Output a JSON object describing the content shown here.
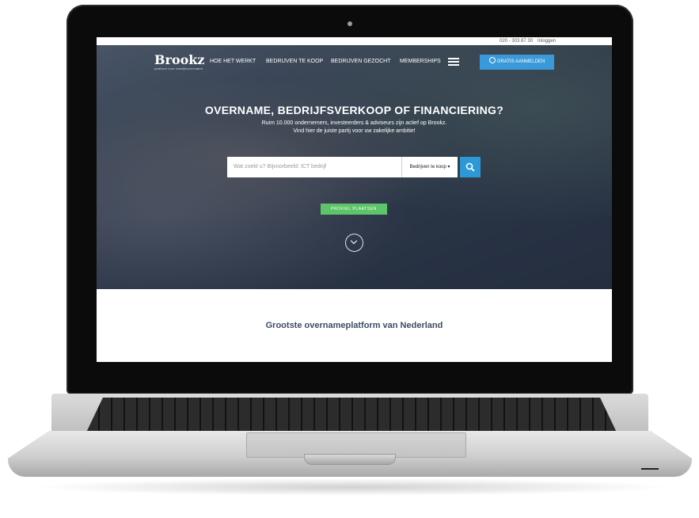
{
  "topbar": {
    "phone": "020 - 303 87 30",
    "login": "Inloggen"
  },
  "logo": {
    "word": "Brookz",
    "tagline": "platform voor bedrijfsovername"
  },
  "nav": {
    "items": [
      "HOE HET WERKT",
      "BEDRIJVEN TE KOOP",
      "BEDRIJVEN GEZOCHT",
      "MEMBERSHIPS"
    ]
  },
  "cta_label": "GRATIS AANMELDEN",
  "hero": {
    "headline": "OVERNAME, BEDRIJFSVERKOOP OF FINANCIERING?",
    "sub1": "Ruim 10.000 ondernemers, investeerders & adviseurs zijn actief op Brookz.",
    "sub2": "Vind hier de juiste partij voor uw zakelijke ambitie!"
  },
  "search": {
    "placeholder": "Wat zoekt u? Bijvoorbeeld: ICT bedrijf",
    "select_value": "Bedrijven te koop ▾"
  },
  "profile_button": "PROFIEL PLAATSEN",
  "section_title": "Grootste overnameplatform van Nederland",
  "colors": {
    "accent": "#3a9ad9",
    "green": "#5ec46a",
    "title": "#3c4c63"
  }
}
